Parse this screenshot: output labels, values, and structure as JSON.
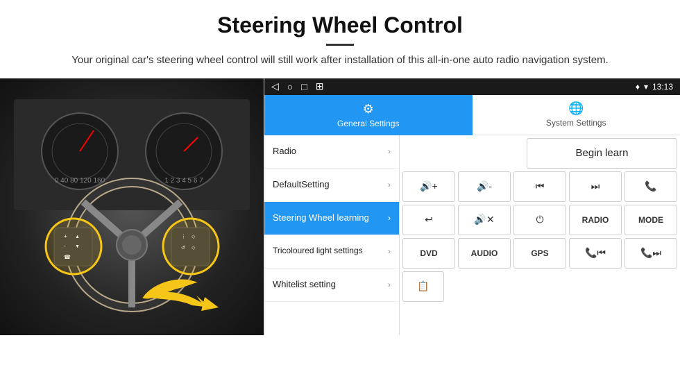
{
  "header": {
    "title": "Steering Wheel Control",
    "subtitle": "Your original car's steering wheel control will still work after installation of this all-in-one auto radio navigation system.",
    "title_divider": true
  },
  "status_bar": {
    "nav_icons": [
      "◁",
      "○",
      "□",
      "⊞"
    ],
    "time": "13:13",
    "signal_icon": "♦",
    "wifi_icon": "▾"
  },
  "tabs": [
    {
      "id": "general",
      "icon": "⚙",
      "label": "General Settings",
      "active": true
    },
    {
      "id": "system",
      "icon": "🌐",
      "label": "System Settings",
      "active": false
    }
  ],
  "menu_items": [
    {
      "id": "radio",
      "label": "Radio",
      "active": false
    },
    {
      "id": "default",
      "label": "DefaultSetting",
      "active": false
    },
    {
      "id": "steering",
      "label": "Steering Wheel learning",
      "active": true
    },
    {
      "id": "tricoloured",
      "label": "Tricoloured light settings",
      "active": false
    },
    {
      "id": "whitelist",
      "label": "Whitelist setting",
      "active": false
    }
  ],
  "buttons": {
    "begin_learn": "Begin learn",
    "rows": [
      [
        "🔊+",
        "🔊-",
        "⏮",
        "⏭",
        "📞"
      ],
      [
        "↩",
        "🔊×",
        "⏻",
        "RADIO",
        "MODE"
      ],
      [
        "DVD",
        "AUDIO",
        "GPS",
        "📞⏮",
        "📞⏭"
      ]
    ]
  }
}
